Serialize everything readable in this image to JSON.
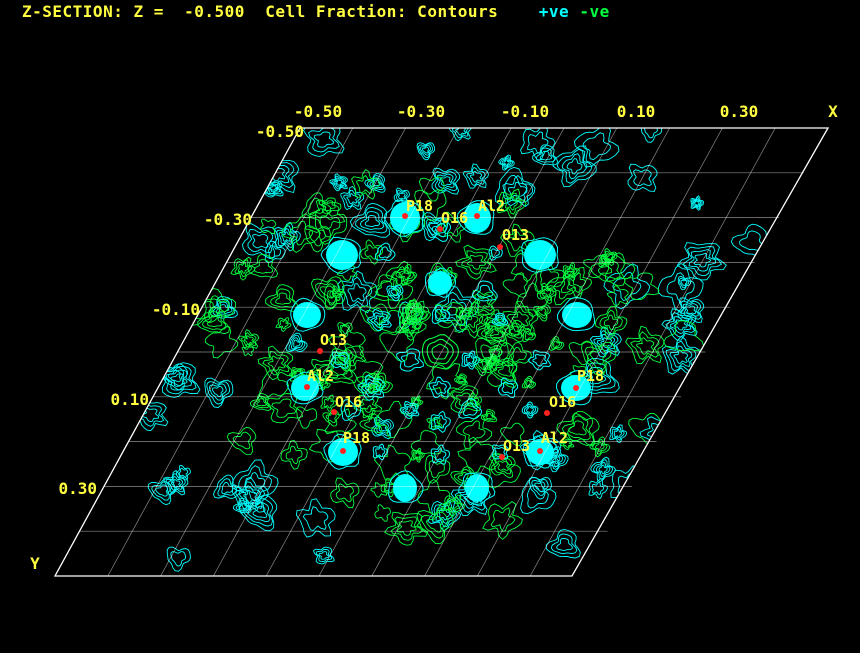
{
  "header": {
    "title": "Z-SECTION: Z =  -0.500  Cell Fraction: Contours",
    "positive_label": "+ve",
    "negative_label": "-ve"
  },
  "colors": {
    "background": "#000000",
    "text": "#ffff40",
    "positive_contour": "#00ffff",
    "negative_contour": "#00ff40",
    "grid": "#ffffff",
    "atom_marker": "#ff2020"
  },
  "axes": {
    "x_label": "X",
    "y_label": "Y",
    "x_ticks": [
      "-0.50",
      "-0.30",
      "-0.10",
      "0.10",
      "0.30"
    ],
    "y_ticks": [
      "-0.50",
      "-0.30",
      "-0.10",
      "0.10",
      "0.30"
    ]
  },
  "atoms": [
    {
      "label": "P18"
    },
    {
      "label": "O16"
    },
    {
      "label": "Al2"
    },
    {
      "label": "O13"
    },
    {
      "label": "O13"
    },
    {
      "label": "Al2"
    },
    {
      "label": "O16"
    },
    {
      "label": "P18"
    },
    {
      "label": "P18"
    },
    {
      "label": "O16"
    },
    {
      "label": "O13"
    },
    {
      "label": "Al2"
    }
  ]
}
